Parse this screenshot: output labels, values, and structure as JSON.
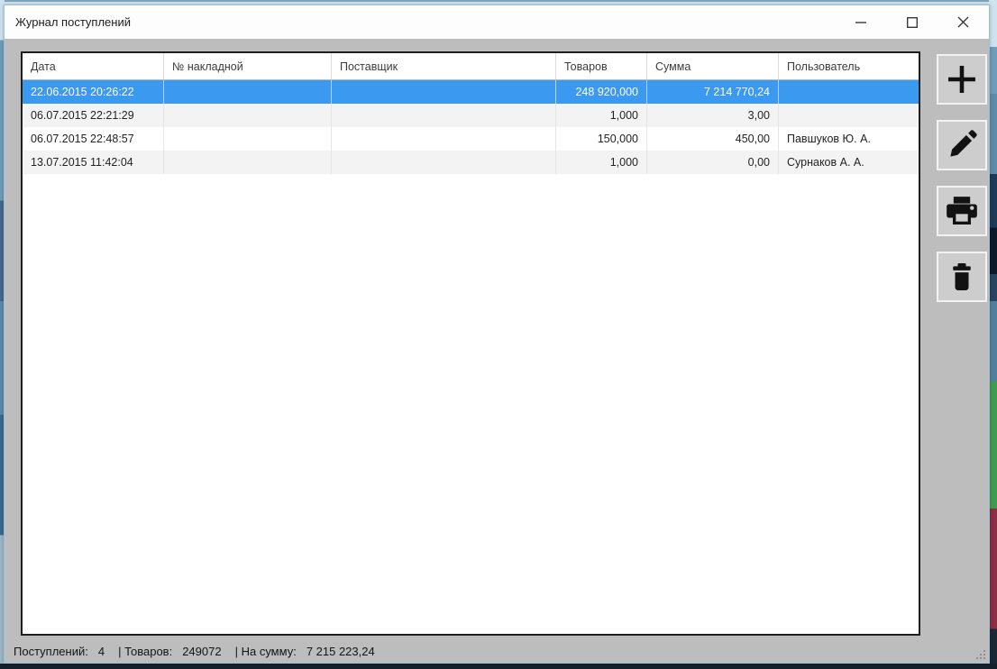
{
  "window": {
    "title": "Журнал поступлений",
    "controls": [
      {
        "name": "minimize"
      },
      {
        "name": "maximize"
      },
      {
        "name": "close"
      }
    ]
  },
  "table": {
    "columns": [
      "Дата",
      "№ накладной",
      "Поставщик",
      "Товаров",
      "Сумма",
      "Пользователь"
    ],
    "rows": [
      {
        "selected": true,
        "cells": [
          "22.06.2015 20:26:22",
          "",
          "",
          "248 920,000",
          "7 214 770,24",
          ""
        ]
      },
      {
        "selected": false,
        "cells": [
          "06.07.2015 22:21:29",
          "",
          "",
          "1,000",
          "3,00",
          ""
        ]
      },
      {
        "selected": false,
        "cells": [
          "06.07.2015 22:48:57",
          "",
          "",
          "150,000",
          "450,00",
          "Павшуков Ю. А."
        ]
      },
      {
        "selected": false,
        "cells": [
          "13.07.2015 11:42:04",
          "",
          "",
          "1,000",
          "0,00",
          "Сурнаков А. А."
        ]
      }
    ]
  },
  "toolbar": {
    "buttons": [
      {
        "name": "add",
        "icon": "plus-icon"
      },
      {
        "name": "edit",
        "icon": "pencil-icon"
      },
      {
        "name": "print",
        "icon": "printer-icon"
      },
      {
        "name": "delete",
        "icon": "trash-icon"
      }
    ]
  },
  "statusbar": {
    "receipts_label": "Поступлений:",
    "receipts_value": "4",
    "goods_label": "| Товаров:",
    "goods_value": "249072",
    "total_label": "| На сумму:",
    "total_value": "7 215 223,24"
  },
  "colors": {
    "selection": "#3b99f0",
    "window_bg": "#bdbdbd",
    "titlebar_bg": "#fdfdfd"
  }
}
